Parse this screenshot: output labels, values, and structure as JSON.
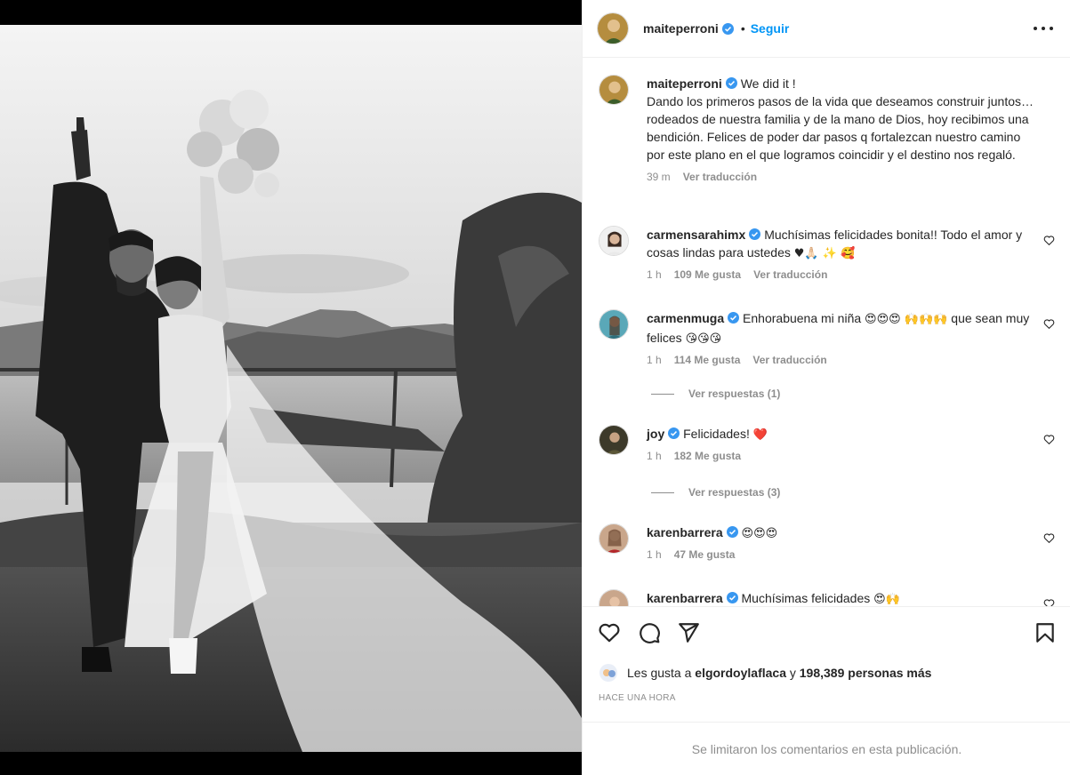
{
  "post": {
    "username": "maiteperroni",
    "follow_label": "Seguir",
    "caption_title": "We did it !",
    "caption_text": "Dando los primeros pasos de la vida que deseamos construir juntos… rodeados de nuestra familia y de la mano de Dios, hoy recibimos una bendición. Felices de poder dar pasos q fortalezcan nuestro camino por este plano en el que logramos coincidir y el destino nos regaló.",
    "caption_time": "39 m",
    "caption_translate": "Ver traducción"
  },
  "comments": [
    {
      "user": "carmensarahimx",
      "text": "Muchísimas felicidades bonita!! Todo el amor y cosas lindas para ustedes",
      "emoji": "♥🙏🏻 ✨ 🥰",
      "time": "1 h",
      "likes": "109 Me gusta",
      "translate": "Ver traducción"
    },
    {
      "user": "carmenmuga",
      "text": "Enhorabuena mi niña",
      "emoji": "😍😍😍 🙌🙌🙌",
      "text2": "que sean muy felices",
      "emoji2": "😘😘😘",
      "time": "1 h",
      "likes": "114 Me gusta",
      "translate": "Ver traducción",
      "replies": "Ver respuestas (1)"
    },
    {
      "user": "joy",
      "text": "Felicidades!",
      "emoji": "❤️",
      "time": "1 h",
      "likes": "182 Me gusta",
      "replies": "Ver respuestas (3)"
    },
    {
      "user": "karenbarrera",
      "text": "",
      "emoji": "😍😍😍",
      "time": "1 h",
      "likes": "47 Me gusta"
    },
    {
      "user": "karenbarrera",
      "text": "Muchísimas felicidades",
      "emoji": "😍🙌"
    }
  ],
  "likes_bar": {
    "prefix": "Les gusta a",
    "user": "elgordoylaflaca",
    "conj": "y",
    "count": "198,389 personas más"
  },
  "time_label": "HACE UNA HORA",
  "limited_label": "Se limitaron los comentarios en esta publicación.",
  "colors": {
    "accent": "#0095f6",
    "verified": "#3897f0",
    "red_heart": "#ed4956"
  }
}
